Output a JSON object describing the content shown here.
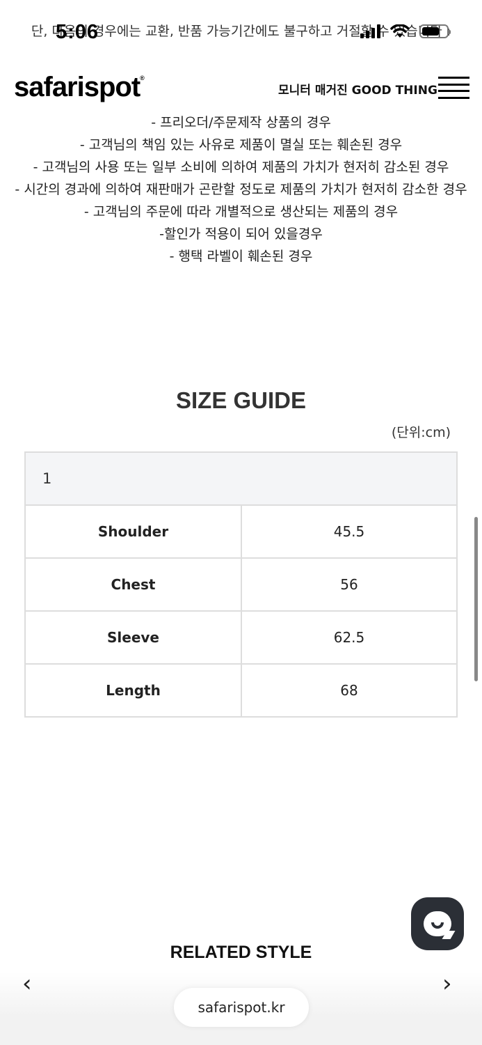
{
  "top_scroll_text": "단, 다음의 경우에는 교환, 반품 가능기간에도 불구하고 거절할 수 있습니다 :",
  "status": {
    "time": "5:06"
  },
  "header": {
    "logo": "safarispot",
    "logo_mark": "®",
    "nav_link": "모니터 매거진 GOOD THING"
  },
  "policy_lines": [
    "- 프리오더/주문제작 상품의 경우",
    "- 고객님의 책임 있는 사유로 제품이 멸실 또는 훼손된 경우",
    "- 고객님의 사용 또는 일부 소비에 의하여 제품의 가치가 현저히 감소된 경우",
    "- 시간의 경과에 의하여 재판매가 곤란할 정도로 제품의 가치가 현저히 감소한 경우",
    "- 고객님의 주문에 따라 개별적으로 생산되는 제품의 경우",
    "-할인가 적용이 되어 있을경우",
    "- 행택 라벨이 훼손된 경우"
  ],
  "size_guide": {
    "title": "SIZE GUIDE",
    "unit": "(단위:cm)",
    "size_header": "1",
    "rows": [
      {
        "label": "Shoulder",
        "value": "45.5"
      },
      {
        "label": "Chest",
        "value": "56"
      },
      {
        "label": "Sleeve",
        "value": "62.5"
      },
      {
        "label": "Length",
        "value": "68"
      }
    ]
  },
  "related": {
    "title": "RELATED STYLE",
    "prev_icon": "‹",
    "next_icon": "›"
  },
  "browser": {
    "url": "safarispot.kr"
  }
}
